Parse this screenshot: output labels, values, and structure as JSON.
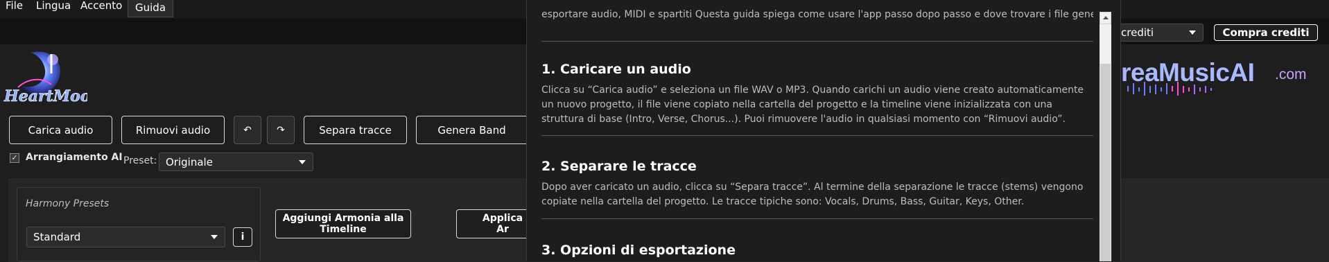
{
  "menubar": {
    "items": [
      "File",
      "Lingua",
      "Accento",
      "Guida"
    ]
  },
  "logo_left": {
    "text": "HeartMoon"
  },
  "logo_right": {
    "text": "reaMusicAI",
    "suffix": ".com"
  },
  "credits": {
    "select_value": "crediti",
    "buy_label": "Compra crediti"
  },
  "toolbar": {
    "load_audio": "Carica audio",
    "remove_audio": "Rimuovi audio",
    "undo_icon": "undo-icon",
    "redo_icon": "redo-icon",
    "separate_tracks": "Separa tracce",
    "generate_band": "Genera Band"
  },
  "arrangement": {
    "checkbox_label": "Arrangiamento AI",
    "checked": true,
    "preset_label": "Preset:",
    "preset_value": "Originale"
  },
  "harmony": {
    "title": "Harmony Presets",
    "select_value": "Standard",
    "info_label": "i",
    "add_button": "Aggiungi Armonia alla Timeline",
    "apply_button": "Applica Ar"
  },
  "help_dialog": {
    "intro": "esportare audio, MIDI e spartiti Questa guida spiega come usare l'app passo dopo passo e dove trovare i file generati.",
    "sections": [
      {
        "title": "1. Caricare un audio",
        "body": "Clicca su “Carica audio” e seleziona un file WAV o MP3. Quando carichi un audio viene creato automaticamente un nuovo progetto, il file viene copiato nella cartella del progetto e la timeline viene inizializzata con una struttura di base (Intro, Verse, Chorus...). Puoi rimuovere l'audio in qualsiasi momento con “Rimuovi audio”."
      },
      {
        "title": "2. Separare le tracce",
        "body": "Dopo aver caricato un audio, clicca su “Separa tracce”. Al termine della separazione le tracce (stems) vengono copiate nella cartella del progetto. Le tracce tipiche sono: Vocals, Drums, Bass, Guitar, Keys, Other."
      },
      {
        "title": "3. Opzioni di esportazione",
        "body": ""
      }
    ]
  }
}
